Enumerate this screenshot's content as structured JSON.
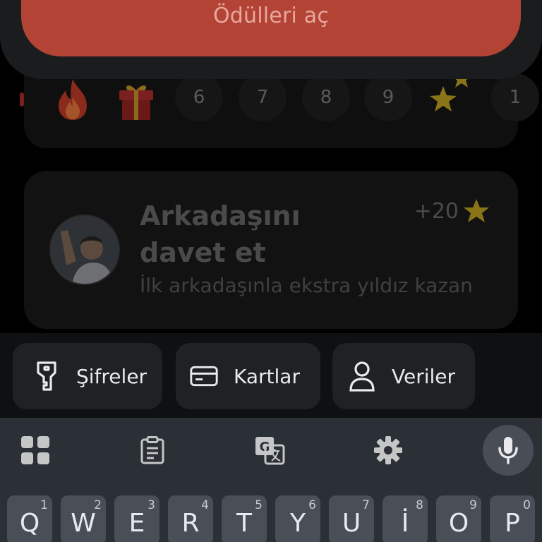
{
  "rewards": {
    "button_label": "Ödülleri aç"
  },
  "streak": {
    "days": [
      "6",
      "7",
      "8",
      "9",
      "1"
    ]
  },
  "invite": {
    "title": "Arkadaşını davet et",
    "reward": "+20",
    "subtitle": "İlk arkadaşınla ekstra yıldız kazan"
  },
  "suggestions": [
    {
      "label": "Şifreler",
      "icon": "key-icon"
    },
    {
      "label": "Kartlar",
      "icon": "card-icon"
    },
    {
      "label": "Veriler",
      "icon": "person-icon"
    }
  ],
  "keyboard": {
    "toolbar": [
      "apps-grid-icon",
      "clipboard-icon",
      "translate-icon",
      "settings-gear-icon",
      "microphone-icon"
    ],
    "row1": [
      {
        "key": "Q",
        "num": "1"
      },
      {
        "key": "W",
        "num": "2"
      },
      {
        "key": "E",
        "num": "3"
      },
      {
        "key": "R",
        "num": "4"
      },
      {
        "key": "T",
        "num": "5"
      },
      {
        "key": "Y",
        "num": "6"
      },
      {
        "key": "U",
        "num": "7"
      },
      {
        "key": "İ",
        "num": "8"
      },
      {
        "key": "O",
        "num": "9"
      },
      {
        "key": "P",
        "num": "0"
      }
    ]
  },
  "colors": {
    "accent": "#b34335",
    "keyboard_bg": "#2b2f36",
    "key_bg": "#4a4f57",
    "chip_bg": "#202124"
  }
}
